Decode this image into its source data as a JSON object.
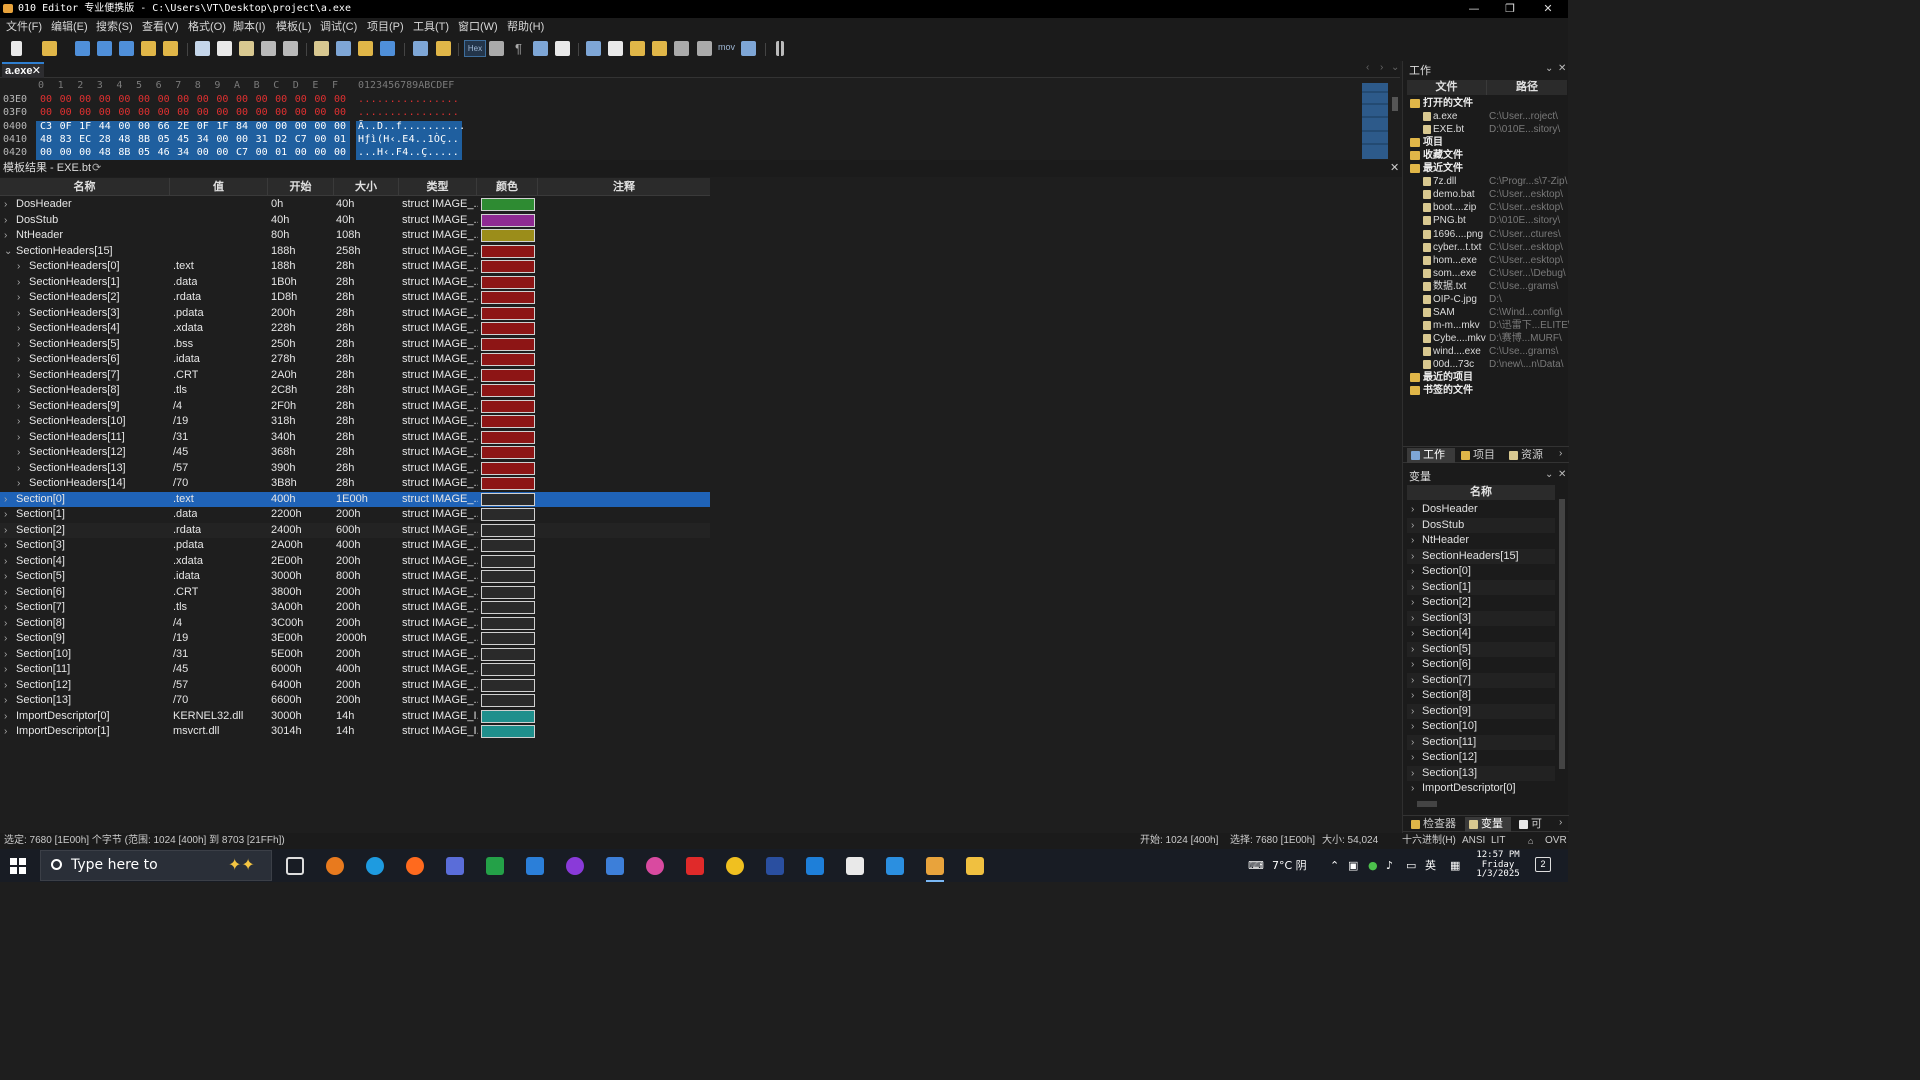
{
  "window": {
    "title": "010 Editor 专业便携版 - C:\\Users\\VT\\Desktop\\project\\a.exe",
    "minimize": "—",
    "restore": "❐",
    "close": "✕"
  },
  "menu": [
    "文件(F)",
    "编辑(E)",
    "搜索(S)",
    "查看(V)",
    "格式(O)",
    "脚本(I)",
    "模板(L)",
    "调试(C)",
    "项目(P)",
    "工具(T)",
    "窗口(W)",
    "帮助(H)"
  ],
  "toolbar": {
    "hex_label": "Hex",
    "mov_label": "mov"
  },
  "doc_tab": {
    "label": "a.exe",
    "close": "✕"
  },
  "hex": {
    "columns": [
      "0",
      "1",
      "2",
      "3",
      "4",
      "5",
      "6",
      "7",
      "8",
      "9",
      "A",
      "B",
      "C",
      "D",
      "E",
      "F"
    ],
    "ascii_header": "0123456789ABCDEF",
    "rows": [
      {
        "addr": "03E0",
        "bytes": [
          "00",
          "00",
          "00",
          "00",
          "00",
          "00",
          "00",
          "00",
          "00",
          "00",
          "00",
          "00",
          "00",
          "00",
          "00",
          "00"
        ],
        "ascii": "................"
      },
      {
        "addr": "03F0",
        "bytes": [
          "00",
          "00",
          "00",
          "00",
          "00",
          "00",
          "00",
          "00",
          "00",
          "00",
          "00",
          "00",
          "00",
          "00",
          "00",
          "00"
        ],
        "ascii": "................"
      },
      {
        "addr": "0400",
        "bytes": [
          "C3",
          "0F",
          "1F",
          "44",
          "00",
          "00",
          "66",
          "2E",
          "0F",
          "1F",
          "84",
          "00",
          "00",
          "00",
          "00",
          "00"
        ],
        "ascii": "Ã..D..f.........."
      },
      {
        "addr": "0410",
        "bytes": [
          "48",
          "83",
          "EC",
          "28",
          "48",
          "8B",
          "05",
          "45",
          "34",
          "00",
          "00",
          "31",
          "D2",
          "C7",
          "00",
          "01"
        ],
        "ascii": "Hƒì(H‹.E4..1ÒÇ.."
      },
      {
        "addr": "0420",
        "bytes": [
          "00",
          "00",
          "00",
          "48",
          "8B",
          "05",
          "46",
          "34",
          "00",
          "00",
          "C7",
          "00",
          "01",
          "00",
          "00",
          "00"
        ],
        "ascii": "...H‹.F4..Ç....."
      }
    ]
  },
  "template": {
    "header": "模板结果 - EXE.bt",
    "refresh_icon": "⟳",
    "close": "✕",
    "columns": {
      "name": "名称",
      "value": "值",
      "start": "开始",
      "size": "大小",
      "type": "类型",
      "color": "颜色",
      "comment": "注释"
    },
    "rows": [
      {
        "arrow": "›",
        "name": "DosHeader",
        "value": "",
        "start": "0h",
        "size": "40h",
        "type": "struct IMAGE_...",
        "color": "#2e8b32",
        "indent": 0
      },
      {
        "arrow": "›",
        "name": "DosStub",
        "value": "",
        "start": "40h",
        "size": "40h",
        "type": "struct IMAGE_...",
        "color": "#8e2a92",
        "indent": 0
      },
      {
        "arrow": "›",
        "name": "NtHeader",
        "value": "",
        "start": "80h",
        "size": "108h",
        "type": "struct IMAGE_...",
        "color": "#9b8d1a",
        "indent": 0
      },
      {
        "arrow": "⌄",
        "name": "SectionHeaders[15]",
        "value": "",
        "start": "188h",
        "size": "258h",
        "type": "struct IMAGE_...",
        "color": "#8d1515",
        "indent": 0
      },
      {
        "arrow": "›",
        "name": "SectionHeaders[0]",
        "value": ".text",
        "start": "188h",
        "size": "28h",
        "type": "struct IMAGE_...",
        "color": "#8d1515",
        "indent": 1
      },
      {
        "arrow": "›",
        "name": "SectionHeaders[1]",
        "value": ".data",
        "start": "1B0h",
        "size": "28h",
        "type": "struct IMAGE_...",
        "color": "#8d1515",
        "indent": 1
      },
      {
        "arrow": "›",
        "name": "SectionHeaders[2]",
        "value": ".rdata",
        "start": "1D8h",
        "size": "28h",
        "type": "struct IMAGE_...",
        "color": "#8d1515",
        "indent": 1
      },
      {
        "arrow": "›",
        "name": "SectionHeaders[3]",
        "value": ".pdata",
        "start": "200h",
        "size": "28h",
        "type": "struct IMAGE_...",
        "color": "#8d1515",
        "indent": 1
      },
      {
        "arrow": "›",
        "name": "SectionHeaders[4]",
        "value": ".xdata",
        "start": "228h",
        "size": "28h",
        "type": "struct IMAGE_...",
        "color": "#8d1515",
        "indent": 1
      },
      {
        "arrow": "›",
        "name": "SectionHeaders[5]",
        "value": ".bss",
        "start": "250h",
        "size": "28h",
        "type": "struct IMAGE_...",
        "color": "#8d1515",
        "indent": 1
      },
      {
        "arrow": "›",
        "name": "SectionHeaders[6]",
        "value": ".idata",
        "start": "278h",
        "size": "28h",
        "type": "struct IMAGE_...",
        "color": "#8d1515",
        "indent": 1
      },
      {
        "arrow": "›",
        "name": "SectionHeaders[7]",
        "value": ".CRT",
        "start": "2A0h",
        "size": "28h",
        "type": "struct IMAGE_...",
        "color": "#8d1515",
        "indent": 1
      },
      {
        "arrow": "›",
        "name": "SectionHeaders[8]",
        "value": ".tls",
        "start": "2C8h",
        "size": "28h",
        "type": "struct IMAGE_...",
        "color": "#8d1515",
        "indent": 1
      },
      {
        "arrow": "›",
        "name": "SectionHeaders[9]",
        "value": "/4",
        "start": "2F0h",
        "size": "28h",
        "type": "struct IMAGE_...",
        "color": "#8d1515",
        "indent": 1
      },
      {
        "arrow": "›",
        "name": "SectionHeaders[10]",
        "value": "/19",
        "start": "318h",
        "size": "28h",
        "type": "struct IMAGE_...",
        "color": "#8d1515",
        "indent": 1
      },
      {
        "arrow": "›",
        "name": "SectionHeaders[11]",
        "value": "/31",
        "start": "340h",
        "size": "28h",
        "type": "struct IMAGE_...",
        "color": "#8d1515",
        "indent": 1
      },
      {
        "arrow": "›",
        "name": "SectionHeaders[12]",
        "value": "/45",
        "start": "368h",
        "size": "28h",
        "type": "struct IMAGE_...",
        "color": "#8d1515",
        "indent": 1
      },
      {
        "arrow": "›",
        "name": "SectionHeaders[13]",
        "value": "/57",
        "start": "390h",
        "size": "28h",
        "type": "struct IMAGE_...",
        "color": "#8d1515",
        "indent": 1
      },
      {
        "arrow": "›",
        "name": "SectionHeaders[14]",
        "value": "/70",
        "start": "3B8h",
        "size": "28h",
        "type": "struct IMAGE_...",
        "color": "#8d1515",
        "indent": 1
      },
      {
        "arrow": "›",
        "name": "Section[0]",
        "value": ".text",
        "start": "400h",
        "size": "1E00h",
        "type": "struct IMAGE_...",
        "color": "#2a2a2a",
        "indent": 0,
        "selected": true
      },
      {
        "arrow": "›",
        "name": "Section[1]",
        "value": ".data",
        "start": "2200h",
        "size": "200h",
        "type": "struct IMAGE_...",
        "color": "#2a2a2a",
        "indent": 0
      },
      {
        "arrow": "›",
        "name": "Section[2]",
        "value": ".rdata",
        "start": "2400h",
        "size": "600h",
        "type": "struct IMAGE_...",
        "color": "#2a2a2a",
        "indent": 0,
        "alt": true
      },
      {
        "arrow": "›",
        "name": "Section[3]",
        "value": ".pdata",
        "start": "2A00h",
        "size": "400h",
        "type": "struct IMAGE_...",
        "color": "#2a2a2a",
        "indent": 0
      },
      {
        "arrow": "›",
        "name": "Section[4]",
        "value": ".xdata",
        "start": "2E00h",
        "size": "200h",
        "type": "struct IMAGE_...",
        "color": "#2a2a2a",
        "indent": 0
      },
      {
        "arrow": "›",
        "name": "Section[5]",
        "value": ".idata",
        "start": "3000h",
        "size": "800h",
        "type": "struct IMAGE_...",
        "color": "#2a2a2a",
        "indent": 0
      },
      {
        "arrow": "›",
        "name": "Section[6]",
        "value": ".CRT",
        "start": "3800h",
        "size": "200h",
        "type": "struct IMAGE_...",
        "color": "#2a2a2a",
        "indent": 0
      },
      {
        "arrow": "›",
        "name": "Section[7]",
        "value": ".tls",
        "start": "3A00h",
        "size": "200h",
        "type": "struct IMAGE_...",
        "color": "#2a2a2a",
        "indent": 0
      },
      {
        "arrow": "›",
        "name": "Section[8]",
        "value": "/4",
        "start": "3C00h",
        "size": "200h",
        "type": "struct IMAGE_...",
        "color": "#2a2a2a",
        "indent": 0
      },
      {
        "arrow": "›",
        "name": "Section[9]",
        "value": "/19",
        "start": "3E00h",
        "size": "2000h",
        "type": "struct IMAGE_...",
        "color": "#2a2a2a",
        "indent": 0
      },
      {
        "arrow": "›",
        "name": "Section[10]",
        "value": "/31",
        "start": "5E00h",
        "size": "200h",
        "type": "struct IMAGE_...",
        "color": "#2a2a2a",
        "indent": 0
      },
      {
        "arrow": "›",
        "name": "Section[11]",
        "value": "/45",
        "start": "6000h",
        "size": "400h",
        "type": "struct IMAGE_...",
        "color": "#2a2a2a",
        "indent": 0
      },
      {
        "arrow": "›",
        "name": "Section[12]",
        "value": "/57",
        "start": "6400h",
        "size": "200h",
        "type": "struct IMAGE_...",
        "color": "#2a2a2a",
        "indent": 0
      },
      {
        "arrow": "›",
        "name": "Section[13]",
        "value": "/70",
        "start": "6600h",
        "size": "200h",
        "type": "struct IMAGE_...",
        "color": "#2a2a2a",
        "indent": 0
      },
      {
        "arrow": "›",
        "name": "ImportDescriptor[0]",
        "value": "KERNEL32.dll",
        "start": "3000h",
        "size": "14h",
        "type": "struct IMAGE_I...",
        "color": "#1f8f8c",
        "indent": 0
      },
      {
        "arrow": "›",
        "name": "ImportDescriptor[1]",
        "value": "msvcrt.dll",
        "start": "3014h",
        "size": "14h",
        "type": "struct IMAGE_I...",
        "color": "#1f8f8c",
        "indent": 0
      }
    ]
  },
  "workspace": {
    "title": "工作",
    "col_file": "文件",
    "col_path": "路径",
    "items": [
      {
        "kind": "group",
        "name": "打开的文件",
        "path": ""
      },
      {
        "kind": "file",
        "name": "a.exe",
        "path": "C:\\User...roject\\"
      },
      {
        "kind": "file",
        "name": "EXE.bt",
        "path": "D:\\010E...sitory\\"
      },
      {
        "kind": "group",
        "name": "项目",
        "path": ""
      },
      {
        "kind": "group",
        "name": "收藏文件",
        "path": ""
      },
      {
        "kind": "group",
        "name": "最近文件",
        "path": ""
      },
      {
        "kind": "file",
        "name": "7z.dll",
        "path": "C:\\Progr...s\\7-Zip\\"
      },
      {
        "kind": "file",
        "name": "demo.bat",
        "path": "C:\\User...esktop\\"
      },
      {
        "kind": "file",
        "name": "boot....zip",
        "path": "C:\\User...esktop\\"
      },
      {
        "kind": "file",
        "name": "PNG.bt",
        "path": "D:\\010E...sitory\\"
      },
      {
        "kind": "file",
        "name": "1696....png",
        "path": "C:\\User...ctures\\"
      },
      {
        "kind": "file",
        "name": "cyber...t.txt",
        "path": "C:\\User...esktop\\"
      },
      {
        "kind": "file",
        "name": "hom...exe",
        "path": "C:\\User...esktop\\"
      },
      {
        "kind": "file",
        "name": "som...exe",
        "path": "C:\\User...\\Debug\\"
      },
      {
        "kind": "file",
        "name": "数据.txt",
        "path": "C:\\Use...grams\\"
      },
      {
        "kind": "file",
        "name": "OIP-C.jpg",
        "path": "D:\\"
      },
      {
        "kind": "file",
        "name": "SAM",
        "path": "C:\\Wind...config\\"
      },
      {
        "kind": "file",
        "name": "m-m...mkv",
        "path": "D:\\迅雷下...ELITE\\"
      },
      {
        "kind": "file",
        "name": "Cybe....mkv",
        "path": "D:\\赛博...MURF\\"
      },
      {
        "kind": "file",
        "name": "wind....exe",
        "path": "C:\\Use...grams\\"
      },
      {
        "kind": "file",
        "name": "00d...73c",
        "path": "D:\\new\\...n\\Data\\"
      },
      {
        "kind": "group",
        "name": "最近的项目",
        "path": ""
      },
      {
        "kind": "group",
        "name": "书签的文件",
        "path": ""
      }
    ],
    "tabs": [
      "工作",
      "项目",
      "资源"
    ]
  },
  "variables": {
    "title": "变量",
    "col_name": "名称",
    "items": [
      "DosHeader",
      "DosStub",
      "NtHeader",
      "SectionHeaders[15]",
      "Section[0]",
      "Section[1]",
      "Section[2]",
      "Section[3]",
      "Section[4]",
      "Section[5]",
      "Section[6]",
      "Section[7]",
      "Section[8]",
      "Section[9]",
      "Section[10]",
      "Section[11]",
      "Section[12]",
      "Section[13]",
      "ImportDescriptor[0]"
    ],
    "tabs": [
      "检查器",
      "变量",
      "可"
    ]
  },
  "status": {
    "selection": "选定: 7680 [1E00h] 个字节 (范围: 1024 [400h] 到 8703 [21FFh])",
    "start": "开始: 1024 [400h]",
    "sel": "选择: 7680 [1E00h]",
    "size": "大小: 54,024",
    "mode": "十六进制(H)",
    "enc": "ANSI",
    "endian": "LIT",
    "ovr": "OVR"
  },
  "taskbar": {
    "search_placeholder": "Type here to",
    "weather": "7°C 阴",
    "lang": "英",
    "time": "12:57 PM",
    "day": "Friday",
    "date": "1/3/2025",
    "notif": "2"
  }
}
